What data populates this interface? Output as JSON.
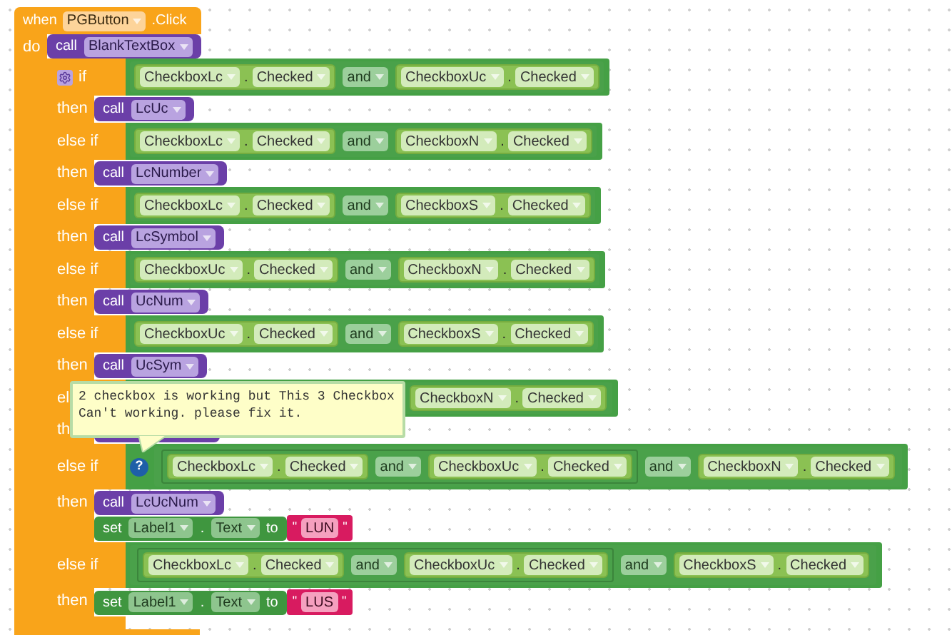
{
  "event": {
    "keyword": "when",
    "component": "PGButton",
    "event": ".Click",
    "do_label": "do"
  },
  "statements": [
    {
      "kind": "call",
      "keyword": "call",
      "procedure": "BlankTextBox"
    },
    {
      "kind": "if",
      "branches": [
        {
          "label": "if",
          "mutator": true,
          "condition": {
            "kind": "and",
            "op": "and",
            "left": {
              "kind": "getter",
              "component": "CheckboxLc",
              "dot": ".",
              "property": "Checked"
            },
            "right": {
              "kind": "getter",
              "component": "CheckboxUc",
              "dot": ".",
              "property": "Checked"
            }
          },
          "then_label": "then",
          "actions": [
            {
              "kind": "call",
              "keyword": "call",
              "procedure": "LcUc"
            }
          ]
        },
        {
          "label": "else if",
          "mutator": false,
          "condition": {
            "kind": "and",
            "op": "and",
            "left": {
              "kind": "getter",
              "component": "CheckboxLc",
              "dot": ".",
              "property": "Checked"
            },
            "right": {
              "kind": "getter",
              "component": "CheckboxN",
              "dot": ".",
              "property": "Checked"
            }
          },
          "then_label": "then",
          "actions": [
            {
              "kind": "call",
              "keyword": "call",
              "procedure": "LcNumber"
            }
          ]
        },
        {
          "label": "else if",
          "mutator": false,
          "condition": {
            "kind": "and",
            "op": "and",
            "left": {
              "kind": "getter",
              "component": "CheckboxLc",
              "dot": ".",
              "property": "Checked"
            },
            "right": {
              "kind": "getter",
              "component": "CheckboxS",
              "dot": ".",
              "property": "Checked"
            }
          },
          "then_label": "then",
          "actions": [
            {
              "kind": "call",
              "keyword": "call",
              "procedure": "LcSymbol"
            }
          ]
        },
        {
          "label": "else if",
          "mutator": false,
          "condition": {
            "kind": "and",
            "op": "and",
            "left": {
              "kind": "getter",
              "component": "CheckboxUc",
              "dot": ".",
              "property": "Checked"
            },
            "right": {
              "kind": "getter",
              "component": "CheckboxN",
              "dot": ".",
              "property": "Checked"
            }
          },
          "then_label": "then",
          "actions": [
            {
              "kind": "call",
              "keyword": "call",
              "procedure": "UcNum"
            }
          ]
        },
        {
          "label": "else if",
          "mutator": false,
          "condition": {
            "kind": "and",
            "op": "and",
            "left": {
              "kind": "getter",
              "component": "CheckboxUc",
              "dot": ".",
              "property": "Checked"
            },
            "right": {
              "kind": "getter",
              "component": "CheckboxS",
              "dot": ".",
              "property": "Checked"
            }
          },
          "then_label": "then",
          "actions": [
            {
              "kind": "call",
              "keyword": "call",
              "procedure": "UcSym"
            }
          ]
        },
        {
          "label": "el",
          "mutator": false,
          "condition": {
            "kind": "partial",
            "right": {
              "kind": "getter",
              "component": "CheckboxN",
              "dot": ".",
              "property": "Checked"
            }
          },
          "then_label": "th",
          "actions": [
            {
              "kind": "covered_call"
            }
          ]
        },
        {
          "label": "else if",
          "mutator": false,
          "comment_icon": "?",
          "condition": {
            "kind": "and",
            "op": "and",
            "left": {
              "kind": "and",
              "op": "and",
              "left": {
                "kind": "getter",
                "component": "CheckboxLc",
                "dot": ".",
                "property": "Checked"
              },
              "right": {
                "kind": "getter",
                "component": "CheckboxUc",
                "dot": ".",
                "property": "Checked"
              }
            },
            "right": {
              "kind": "getter",
              "component": "CheckboxN",
              "dot": ".",
              "property": "Checked"
            }
          },
          "then_label": "then",
          "actions": [
            {
              "kind": "call",
              "keyword": "call",
              "procedure": "LcUcNum"
            },
            {
              "kind": "set",
              "keyword": "set",
              "component": "Label1",
              "dot": ".",
              "property": "Text",
              "to": "to",
              "quote_open": "\"",
              "value": "LUN",
              "quote_close": "\""
            }
          ]
        },
        {
          "label": "else if",
          "mutator": false,
          "condition": {
            "kind": "and",
            "op": "and",
            "left": {
              "kind": "and",
              "op": "and",
              "left": {
                "kind": "getter",
                "component": "CheckboxLc",
                "dot": ".",
                "property": "Checked"
              },
              "right": {
                "kind": "getter",
                "component": "CheckboxUc",
                "dot": ".",
                "property": "Checked"
              }
            },
            "right": {
              "kind": "getter",
              "component": "CheckboxS",
              "dot": ".",
              "property": "Checked"
            }
          },
          "then_label": "then",
          "actions": [
            {
              "kind": "set",
              "keyword": "set",
              "component": "Label1",
              "dot": ".",
              "property": "Text",
              "to": "to",
              "quote_open": "\"",
              "value": "LUS",
              "quote_close": "\""
            }
          ]
        }
      ]
    }
  ],
  "comment": {
    "text": "2 checkbox is working but This 3 Checkbox\nCan't working. please fix it."
  }
}
